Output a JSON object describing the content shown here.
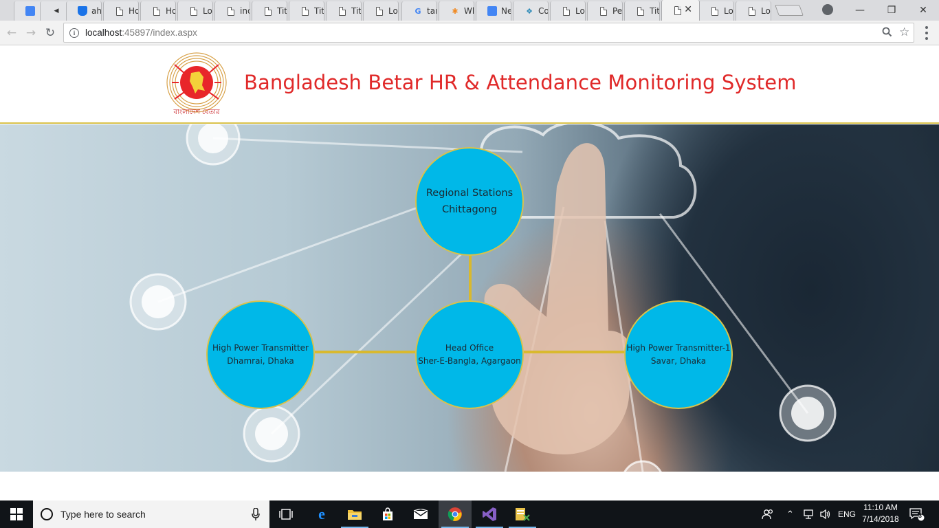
{
  "browser": {
    "tabs": [
      {
        "label": "",
        "icon": "google-translate-icon"
      },
      {
        "label": "",
        "icon": "speaker-icon"
      },
      {
        "label": "ahi",
        "icon": "shield-icon"
      },
      {
        "label": "Ho",
        "icon": "page-icon"
      },
      {
        "label": "Ho",
        "icon": "page-icon"
      },
      {
        "label": "Log",
        "icon": "page-icon"
      },
      {
        "label": "ind",
        "icon": "page-icon"
      },
      {
        "label": "Titl",
        "icon": "page-icon"
      },
      {
        "label": "Titl",
        "icon": "page-icon"
      },
      {
        "label": "Titl",
        "icon": "page-icon"
      },
      {
        "label": "Log",
        "icon": "page-icon"
      },
      {
        "label": "tar",
        "icon": "google-icon"
      },
      {
        "label": "Wh",
        "icon": "asterisk-icon"
      },
      {
        "label": "Ne",
        "icon": "docs-icon"
      },
      {
        "label": "Co",
        "icon": "puzzle-icon"
      },
      {
        "label": "Log",
        "icon": "page-icon"
      },
      {
        "label": "Per",
        "icon": "page-icon"
      },
      {
        "label": "Titl",
        "icon": "page-icon"
      },
      {
        "label": "",
        "icon": "page-icon",
        "active": true
      },
      {
        "label": "Log",
        "icon": "page-icon"
      },
      {
        "label": "Log",
        "icon": "page-icon"
      }
    ],
    "url_host": "localhost",
    "url_rest": ":45897/index.aspx"
  },
  "site": {
    "title": "Bangladesh Betar HR & Attendance Monitoring System",
    "logo_text": "বাংলাদেশ বেতার"
  },
  "nodes": {
    "top": {
      "line1": "Regional Stations",
      "line2": "Chittagong"
    },
    "center": {
      "line1": "Head Office",
      "line2": "Sher-E-Bangla, Agargaon"
    },
    "left": {
      "line1": "High Power Transmitter",
      "line2": "Dhamrai, Dhaka"
    },
    "right": {
      "line1": "High Power Transmitter-1",
      "line2": "Savar, Dhaka"
    }
  },
  "colors": {
    "title": "#e02929",
    "node_fill": "#00b8e8",
    "connector": "#d9b92e"
  },
  "taskbar": {
    "search_placeholder": "Type here to search",
    "language": "ENG",
    "time": "11:10 AM",
    "date": "7/14/2018",
    "notification_count": "3"
  }
}
